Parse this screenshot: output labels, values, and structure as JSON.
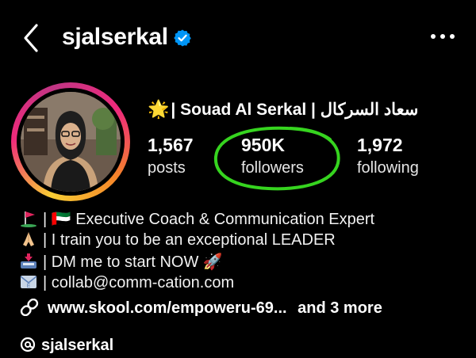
{
  "header": {
    "back_icon": "chevron-left-icon",
    "username": "sjalserkal",
    "verified_icon": "verified-badge-icon",
    "more_icon": "more-horizontal-icon"
  },
  "profile": {
    "display_name_prefix": "🌟",
    "display_name": "| Souad Al Serkal | سعاد السركال",
    "stats": [
      {
        "value": "1,567",
        "label": "posts"
      },
      {
        "value": "950K",
        "label": "followers"
      },
      {
        "value": "1,972",
        "label": "following"
      }
    ],
    "annotation_color": "#36d41f",
    "ring_colors": [
      "#f9ce34",
      "#ee2a7b",
      "#c13584"
    ]
  },
  "bio": {
    "lines": [
      {
        "icon": "golf-flag-icon",
        "text": "| 🇦🇪 Executive Coach & Communication Expert"
      },
      {
        "icon": "praying-hands-icon",
        "text": "| I train you to be an exceptional LEADER"
      },
      {
        "icon": "inbox-tray-icon",
        "text": "| DM me to start NOW 🚀"
      },
      {
        "icon": "email-icon",
        "text": "| collab@comm-cation.com"
      }
    ],
    "link_text": "www.skool.com/empoweru-69...",
    "link_more": "and 3 more",
    "threads_handle": "sjalserkal"
  }
}
